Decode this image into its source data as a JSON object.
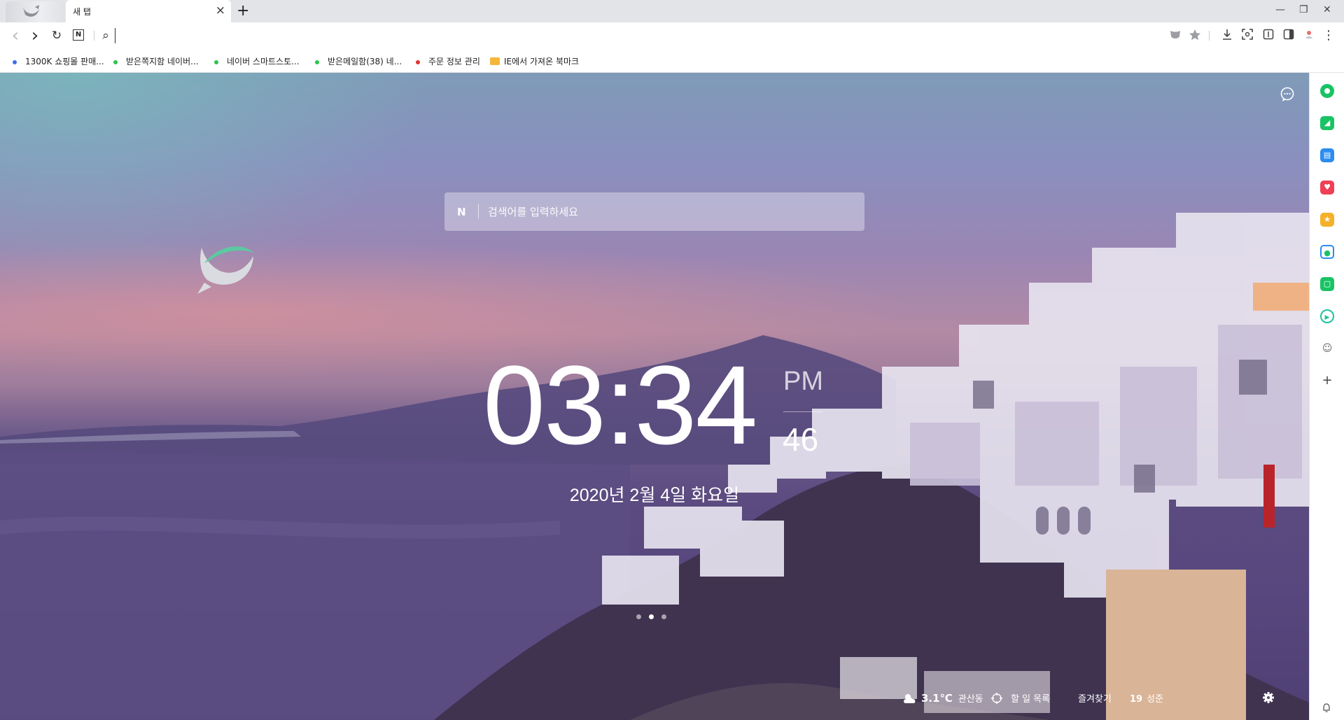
{
  "tabs": [
    {
      "title": "새 탭",
      "active": true
    }
  ],
  "tab_actions": {
    "close": "×",
    "new_tab": "+"
  },
  "window_controls": {
    "minimize": "—",
    "restore": "❐",
    "close": "✕"
  },
  "nav": {
    "back": "‹",
    "forward": "›",
    "reload": "↻",
    "naver": "N",
    "search_glyph": "⌕",
    "address_value": ""
  },
  "bookmarks": [
    {
      "label": "1300K 쇼핑몰 판매...",
      "color": "#3d6fe8"
    },
    {
      "label": "받은쪽지함   네이버...",
      "color": "#2cc54a"
    },
    {
      "label": "네이버 스마트스토...",
      "color": "#2cc54a"
    },
    {
      "label": "받은메일함(38)   네...",
      "color": "#2cc54a"
    },
    {
      "label": "주문 정보 관리",
      "color": "#e0352b"
    },
    {
      "label": "IE에서 가져온 북마크",
      "folder": true
    }
  ],
  "search": {
    "logo": "N",
    "placeholder": "검색어를 입력하세요"
  },
  "clock": {
    "time": "03:34",
    "ampm": "PM",
    "seconds": "46",
    "date": "2020년 2월 4일 화요일"
  },
  "bottom": {
    "weather_temp": "3.1℃",
    "weather_location": "관산동",
    "todo": "할 일 목록",
    "favorites": "즐겨찾기",
    "horoscope_num": "19",
    "horoscope": "성준"
  },
  "sidebar": {
    "items": [
      {
        "icon": "green-circle-icon",
        "color": "#19c364"
      },
      {
        "icon": "bell-icon",
        "color": "#19c364"
      },
      {
        "icon": "calendar-icon",
        "color": "#2c8cf0"
      },
      {
        "icon": "pocket-icon",
        "color": "#ef4056"
      },
      {
        "icon": "star-icon",
        "color": "#f5b12a"
      },
      {
        "icon": "translate-icon",
        "color": "#2c8cf0"
      },
      {
        "icon": "memo-icon",
        "color": "#19c364"
      },
      {
        "icon": "play-icon",
        "color": "#1fc39a"
      },
      {
        "icon": "papago-icon",
        "color": "#666666"
      }
    ],
    "add": "+"
  },
  "colors": {
    "accent": "#19c364"
  }
}
